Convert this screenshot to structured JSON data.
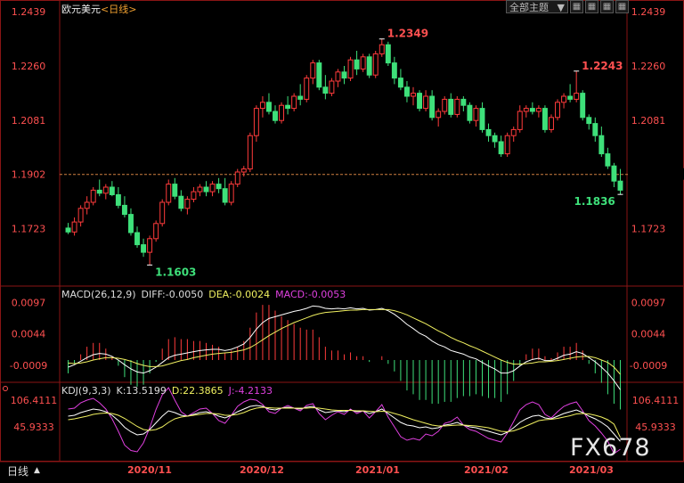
{
  "header": {
    "title": "欧元美元",
    "period_link": "<日线>",
    "theme_select": "全部主题",
    "buttons": [
      "grid",
      "grid2",
      "grid3",
      "grid4"
    ]
  },
  "colors": {
    "up": "#ff3b3b",
    "down": "#3ee07a",
    "diff": "#ffffff",
    "dea": "#f0f060",
    "macd": "#e040e0",
    "k": "#ffffff",
    "d": "#f0f060",
    "j": "#e040e0",
    "axis_text": "#ff5050"
  },
  "main_panel": {
    "y_ticks": [
      "1.2439",
      "1.2260",
      "1.2081",
      "1.1902",
      "1.1723"
    ],
    "current_price": "1.1902",
    "annotations": {
      "high": "1.2349",
      "high2": "1.2243",
      "low": "1.1603",
      "low2": "1.1836"
    }
  },
  "macd_panel": {
    "label": "MACD(26,12,9)",
    "diff": "DIFF:-0.0050",
    "dea": "DEA:-0.0024",
    "macd": "MACD:-0.0053",
    "y_ticks": [
      "0.0097",
      "0.0044",
      "-0.0009"
    ]
  },
  "kdj_panel": {
    "label": "KDJ(9,3,3)",
    "k": "K:13.5199",
    "d": "D:22.3865",
    "j": "J:-4.2133",
    "y_ticks": [
      "106.4111",
      "45.9333"
    ]
  },
  "x_axis": [
    "2020/11",
    "2020/12",
    "2021/01",
    "2021/02",
    "2021/03"
  ],
  "bottom_tab": "日线",
  "watermark": "FX678",
  "chart_data": {
    "type": "candlestick",
    "ylim": [
      1.156,
      1.246
    ],
    "candles": [
      [
        1.1725,
        1.1742,
        1.1705,
        1.1712
      ],
      [
        1.1712,
        1.176,
        1.17,
        1.1745
      ],
      [
        1.1745,
        1.18,
        1.173,
        1.179
      ],
      [
        1.179,
        1.183,
        1.177,
        1.181
      ],
      [
        1.181,
        1.186,
        1.18,
        1.185
      ],
      [
        1.185,
        1.1885,
        1.183,
        1.184
      ],
      [
        1.184,
        1.187,
        1.182,
        1.186
      ],
      [
        1.186,
        1.188,
        1.183,
        1.1835
      ],
      [
        1.1835,
        1.186,
        1.179,
        1.18
      ],
      [
        1.18,
        1.183,
        1.176,
        1.177
      ],
      [
        1.177,
        1.179,
        1.17,
        1.171
      ],
      [
        1.171,
        1.173,
        1.166,
        1.167
      ],
      [
        1.167,
        1.169,
        1.163,
        1.1645
      ],
      [
        1.1645,
        1.17,
        1.1603,
        1.169
      ],
      [
        1.169,
        1.175,
        1.168,
        1.174
      ],
      [
        1.174,
        1.182,
        1.173,
        1.181
      ],
      [
        1.181,
        1.1885,
        1.18,
        1.187
      ],
      [
        1.187,
        1.189,
        1.182,
        1.183
      ],
      [
        1.183,
        1.185,
        1.178,
        1.179
      ],
      [
        1.179,
        1.183,
        1.177,
        1.182
      ],
      [
        1.182,
        1.186,
        1.181,
        1.1845
      ],
      [
        1.1845,
        1.187,
        1.183,
        1.186
      ],
      [
        1.186,
        1.188,
        1.183,
        1.1845
      ],
      [
        1.1845,
        1.188,
        1.183,
        1.187
      ],
      [
        1.187,
        1.189,
        1.184,
        1.1855
      ],
      [
        1.1855,
        1.189,
        1.18,
        1.181
      ],
      [
        1.181,
        1.188,
        1.18,
        1.187
      ],
      [
        1.187,
        1.192,
        1.186,
        1.191
      ],
      [
        1.191,
        1.193,
        1.1895,
        1.192
      ],
      [
        1.192,
        1.204,
        1.191,
        1.203
      ],
      [
        1.203,
        1.213,
        1.201,
        1.212
      ],
      [
        1.212,
        1.216,
        1.209,
        1.214
      ],
      [
        1.214,
        1.217,
        1.21,
        1.211
      ],
      [
        1.211,
        1.213,
        1.207,
        1.208
      ],
      [
        1.208,
        1.214,
        1.207,
        1.213
      ],
      [
        1.213,
        1.216,
        1.21,
        1.212
      ],
      [
        1.212,
        1.217,
        1.211,
        1.216
      ],
      [
        1.216,
        1.22,
        1.213,
        1.215
      ],
      [
        1.215,
        1.223,
        1.214,
        1.222
      ],
      [
        1.222,
        1.228,
        1.22,
        1.227
      ],
      [
        1.227,
        1.228,
        1.218,
        1.219
      ],
      [
        1.219,
        1.223,
        1.215,
        1.217
      ],
      [
        1.217,
        1.222,
        1.216,
        1.221
      ],
      [
        1.221,
        1.225,
        1.219,
        1.224
      ],
      [
        1.224,
        1.226,
        1.22,
        1.222
      ],
      [
        1.222,
        1.229,
        1.221,
        1.228
      ],
      [
        1.228,
        1.231,
        1.223,
        1.225
      ],
      [
        1.225,
        1.23,
        1.224,
        1.229
      ],
      [
        1.229,
        1.23,
        1.222,
        1.223
      ],
      [
        1.223,
        1.231,
        1.222,
        1.23
      ],
      [
        1.23,
        1.2349,
        1.229,
        1.233
      ],
      [
        1.233,
        1.234,
        1.226,
        1.227
      ],
      [
        1.227,
        1.229,
        1.22,
        1.222
      ],
      [
        1.222,
        1.225,
        1.218,
        1.219
      ],
      [
        1.219,
        1.221,
        1.214,
        1.216
      ],
      [
        1.216,
        1.219,
        1.213,
        1.217
      ],
      [
        1.217,
        1.218,
        1.211,
        1.212
      ],
      [
        1.212,
        1.218,
        1.211,
        1.216
      ],
      [
        1.216,
        1.218,
        1.208,
        1.209
      ],
      [
        1.209,
        1.212,
        1.206,
        1.211
      ],
      [
        1.211,
        1.216,
        1.21,
        1.215
      ],
      [
        1.215,
        1.217,
        1.209,
        1.21
      ],
      [
        1.21,
        1.216,
        1.209,
        1.215
      ],
      [
        1.215,
        1.216,
        1.211,
        1.213
      ],
      [
        1.213,
        1.214,
        1.207,
        1.208
      ],
      [
        1.208,
        1.213,
        1.206,
        1.212
      ],
      [
        1.212,
        1.214,
        1.204,
        1.205
      ],
      [
        1.205,
        1.207,
        1.201,
        1.203
      ],
      [
        1.203,
        1.204,
        1.199,
        1.201
      ],
      [
        1.201,
        1.203,
        1.196,
        1.197
      ],
      [
        1.197,
        1.204,
        1.196,
        1.203
      ],
      [
        1.203,
        1.206,
        1.201,
        1.205
      ],
      [
        1.205,
        1.213,
        1.204,
        1.211
      ],
      [
        1.211,
        1.213,
        1.209,
        1.212
      ],
      [
        1.212,
        1.214,
        1.21,
        1.211
      ],
      [
        1.211,
        1.213,
        1.209,
        1.212
      ],
      [
        1.212,
        1.213,
        1.204,
        1.205
      ],
      [
        1.205,
        1.21,
        1.204,
        1.209
      ],
      [
        1.209,
        1.215,
        1.208,
        1.214
      ],
      [
        1.214,
        1.217,
        1.212,
        1.216
      ],
      [
        1.216,
        1.22,
        1.214,
        1.215
      ],
      [
        1.215,
        1.2243,
        1.214,
        1.217
      ],
      [
        1.217,
        1.218,
        1.208,
        1.209
      ],
      [
        1.209,
        1.21,
        1.205,
        1.207
      ],
      [
        1.207,
        1.209,
        1.201,
        1.203
      ],
      [
        1.203,
        1.206,
        1.196,
        1.197
      ],
      [
        1.197,
        1.199,
        1.192,
        1.193
      ],
      [
        1.193,
        1.194,
        1.186,
        1.188
      ],
      [
        1.188,
        1.192,
        1.1836,
        1.185
      ]
    ],
    "macd": {
      "diff": [
        -0.0012,
        -0.0008,
        -0.0002,
        0.0004,
        0.0009,
        0.0011,
        0.001,
        0.0006,
        0.0,
        -0.0008,
        -0.0015,
        -0.002,
        -0.0022,
        -0.0018,
        -0.0012,
        -0.0004,
        0.0004,
        0.0008,
        0.001,
        0.0012,
        0.0014,
        0.0016,
        0.0017,
        0.0018,
        0.0018,
        0.0016,
        0.0018,
        0.0022,
        0.0027,
        0.0038,
        0.0052,
        0.0063,
        0.007,
        0.0073,
        0.0076,
        0.0079,
        0.0082,
        0.0084,
        0.0087,
        0.0091,
        0.009,
        0.0087,
        0.0086,
        0.0087,
        0.0086,
        0.0088,
        0.0086,
        0.0087,
        0.0084,
        0.0085,
        0.0087,
        0.0083,
        0.0077,
        0.0069,
        0.006,
        0.0053,
        0.0045,
        0.004,
        0.0032,
        0.0026,
        0.0022,
        0.0016,
        0.0013,
        0.001,
        0.0005,
        0.0002,
        -0.0004,
        -0.001,
        -0.0015,
        -0.0022,
        -0.0022,
        -0.0018,
        -0.001,
        -0.0003,
        0.0001,
        0.0003,
        -0.0001,
        -0.0001,
        0.0003,
        0.0008,
        0.001,
        0.0014,
        0.0011,
        0.0004,
        -0.0003,
        -0.0012,
        -0.0022,
        -0.0035,
        -0.005
      ],
      "dea": [
        -0.0005,
        -0.0006,
        -0.0005,
        -0.0003,
        0.0,
        0.0002,
        0.0004,
        0.0004,
        0.0003,
        0.0001,
        -0.0002,
        -0.0006,
        -0.0009,
        -0.0011,
        -0.0011,
        -0.001,
        -0.0007,
        -0.0004,
        -0.0001,
        0.0001,
        0.0004,
        0.0006,
        0.0008,
        0.001,
        0.0011,
        0.0012,
        0.0013,
        0.0015,
        0.0017,
        0.0021,
        0.0027,
        0.0034,
        0.0041,
        0.0047,
        0.0053,
        0.0058,
        0.0063,
        0.0067,
        0.0071,
        0.0075,
        0.0078,
        0.008,
        0.0081,
        0.0082,
        0.0083,
        0.0084,
        0.0084,
        0.0085,
        0.0085,
        0.0085,
        0.0085,
        0.0085,
        0.0083,
        0.008,
        0.0076,
        0.0071,
        0.0066,
        0.0061,
        0.0055,
        0.0049,
        0.0044,
        0.0038,
        0.0033,
        0.0029,
        0.0024,
        0.002,
        0.0015,
        0.001,
        0.0005,
        0.0,
        -0.0004,
        -0.0007,
        -0.0007,
        -0.0006,
        -0.0005,
        -0.0003,
        -0.0003,
        -0.0002,
        -0.0001,
        0.0001,
        0.0003,
        0.0005,
        0.0006,
        0.0006,
        0.0004,
        0.0,
        -0.0004,
        -0.0012,
        -0.0024
      ]
    },
    "kdj": {
      "k": [
        70,
        72,
        78,
        82,
        86,
        84,
        80,
        72,
        60,
        45,
        35,
        28,
        30,
        40,
        55,
        70,
        82,
        78,
        72,
        70,
        74,
        78,
        80,
        76,
        70,
        66,
        72,
        80,
        86,
        92,
        94,
        92,
        86,
        84,
        88,
        90,
        88,
        86,
        90,
        92,
        84,
        78,
        80,
        82,
        80,
        84,
        80,
        82,
        76,
        80,
        86,
        76,
        66,
        56,
        50,
        48,
        44,
        46,
        42,
        44,
        50,
        52,
        56,
        50,
        46,
        44,
        40,
        36,
        32,
        28,
        34,
        44,
        56,
        64,
        70,
        72,
        66,
        64,
        70,
        76,
        80,
        84,
        78,
        70,
        64,
        56,
        46,
        30,
        13.5
      ],
      "d": [
        62,
        64,
        67,
        70,
        74,
        76,
        77,
        76,
        72,
        65,
        56,
        47,
        40,
        38,
        40,
        46,
        56,
        64,
        68,
        70,
        72,
        74,
        76,
        76,
        75,
        72,
        72,
        74,
        78,
        84,
        88,
        90,
        89,
        88,
        88,
        88,
        88,
        88,
        88,
        89,
        88,
        86,
        84,
        83,
        83,
        83,
        82,
        82,
        81,
        80,
        81,
        80,
        76,
        72,
        67,
        62,
        58,
        54,
        50,
        48,
        48,
        49,
        50,
        50,
        49,
        48,
        46,
        44,
        40,
        36,
        35,
        37,
        42,
        48,
        54,
        60,
        62,
        63,
        65,
        68,
        71,
        75,
        76,
        75,
        72,
        68,
        62,
        52,
        22.4
      ],
      "j": [
        86,
        88,
        100,
        106,
        110,
        100,
        86,
        64,
        36,
        5,
        -7,
        -10,
        10,
        44,
        85,
        118,
        134,
        106,
        80,
        70,
        78,
        86,
        88,
        76,
        60,
        54,
        72,
        92,
        102,
        108,
        106,
        96,
        80,
        76,
        88,
        94,
        88,
        82,
        94,
        98,
        76,
        62,
        72,
        80,
        74,
        86,
        76,
        82,
        66,
        80,
        96,
        68,
        46,
        24,
        16,
        20,
        16,
        30,
        26,
        36,
        54,
        58,
        68,
        50,
        40,
        36,
        28,
        20,
        16,
        12,
        32,
        58,
        84,
        96,
        102,
        96,
        74,
        66,
        80,
        92,
        98,
        102,
        82,
        60,
        48,
        32,
        14,
        -14,
        -4.2
      ]
    }
  }
}
